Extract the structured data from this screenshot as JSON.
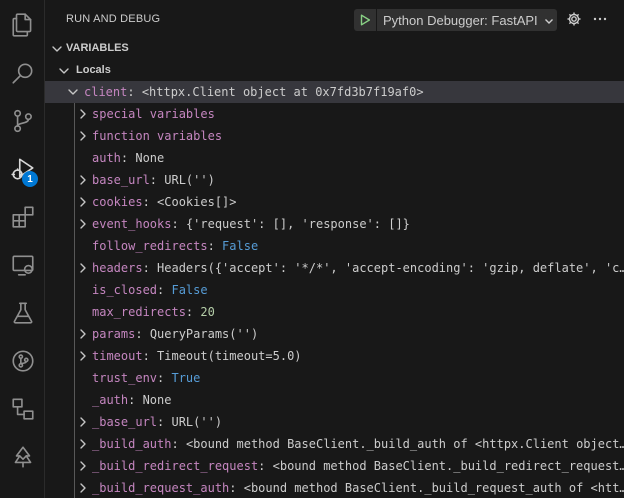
{
  "header": {
    "title": "RUN AND DEBUG",
    "launch_config": "Python Debugger: FastAPI"
  },
  "activity_bar": {
    "icons": [
      "files-icon",
      "search-icon",
      "source-control-icon",
      "run-debug-icon",
      "extensions-icon",
      "remote-explorer-icon",
      "testing-icon",
      "git-graph-icon",
      "diagram-icon",
      "tree-icon"
    ],
    "debug_badge": "1"
  },
  "variables": {
    "section_label": "VARIABLES",
    "scope_label": "Locals",
    "rows": [
      {
        "name": "client",
        "value": "<httpx.Client object at 0x7fd3b7f19af0>",
        "expandable": true,
        "expanded": true,
        "level": 0,
        "selected": true,
        "kind": "obj"
      },
      {
        "name": "special variables",
        "value": "",
        "expandable": true,
        "level": 1,
        "kind": "group"
      },
      {
        "name": "function variables",
        "value": "",
        "expandable": true,
        "level": 1,
        "kind": "group"
      },
      {
        "name": "auth",
        "value": "None",
        "expandable": false,
        "level": 1,
        "kind": "obj"
      },
      {
        "name": "base_url",
        "value": "URL('')",
        "expandable": true,
        "level": 1,
        "kind": "obj"
      },
      {
        "name": "cookies",
        "value": "<Cookies[]>",
        "expandable": true,
        "level": 1,
        "kind": "obj"
      },
      {
        "name": "event_hooks",
        "value": "{'request': [], 'response': []}",
        "expandable": true,
        "level": 1,
        "kind": "obj"
      },
      {
        "name": "follow_redirects",
        "value": "False",
        "expandable": false,
        "level": 1,
        "kind": "bool"
      },
      {
        "name": "headers",
        "value": "Headers({'accept': '*/*', 'accept-encoding': 'gzip, deflate', 'c…",
        "expandable": true,
        "level": 1,
        "kind": "obj"
      },
      {
        "name": "is_closed",
        "value": "False",
        "expandable": false,
        "level": 1,
        "kind": "bool"
      },
      {
        "name": "max_redirects",
        "value": "20",
        "expandable": false,
        "level": 1,
        "kind": "num"
      },
      {
        "name": "params",
        "value": "QueryParams('')",
        "expandable": true,
        "level": 1,
        "kind": "obj"
      },
      {
        "name": "timeout",
        "value": "Timeout(timeout=5.0)",
        "expandable": true,
        "level": 1,
        "kind": "obj"
      },
      {
        "name": "trust_env",
        "value": "True",
        "expandable": false,
        "level": 1,
        "kind": "bool"
      },
      {
        "name": "_auth",
        "value": "None",
        "expandable": false,
        "level": 1,
        "kind": "obj"
      },
      {
        "name": "_base_url",
        "value": "URL('')",
        "expandable": true,
        "level": 1,
        "kind": "obj"
      },
      {
        "name": "_build_auth",
        "value": "<bound method BaseClient._build_auth of <httpx.Client object…",
        "expandable": true,
        "level": 1,
        "kind": "obj"
      },
      {
        "name": "_build_redirect_request",
        "value": "<bound method BaseClient._build_redirect_request…",
        "expandable": true,
        "level": 1,
        "kind": "obj"
      },
      {
        "name": "_build_request_auth",
        "value": "<bound method BaseClient._build_request_auth of <htt…",
        "expandable": true,
        "level": 1,
        "kind": "obj"
      }
    ]
  }
}
